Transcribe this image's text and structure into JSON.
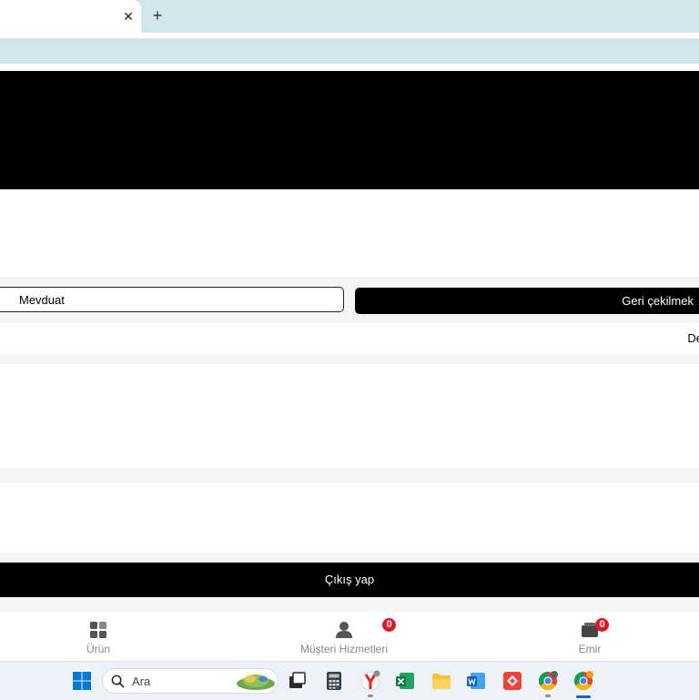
{
  "browser": {
    "tab_close_glyph": "✕",
    "new_tab_glyph": "+"
  },
  "account": {
    "deposit_label": "Mevduat",
    "withdraw_label": "Geri çekilmek",
    "info_row_text": "De",
    "logout_label": "Çıkış yap"
  },
  "bottom_nav": {
    "items": [
      {
        "label": "Ürün",
        "icon": "grid-icon"
      },
      {
        "label": "Müşteri Hizmetleri",
        "icon": "user-icon",
        "badge": "0"
      },
      {
        "label": "Emir",
        "icon": "order-icon",
        "badge": "0"
      }
    ]
  },
  "taskbar": {
    "search_placeholder": "Ara",
    "icons": [
      "windows-start-icon",
      "search-icon",
      "task-view-icon",
      "calculator-icon",
      "yandex-icon",
      "excel-icon",
      "file-explorer-icon",
      "word-icon",
      "anydesk-icon",
      "chrome-icon",
      "chrome-profile-icon"
    ]
  },
  "colors": {
    "chrome_bg": "#d3e6ec",
    "banner": "#000000",
    "badge": "#e0182d",
    "taskbar_accent": "#0067c0"
  }
}
